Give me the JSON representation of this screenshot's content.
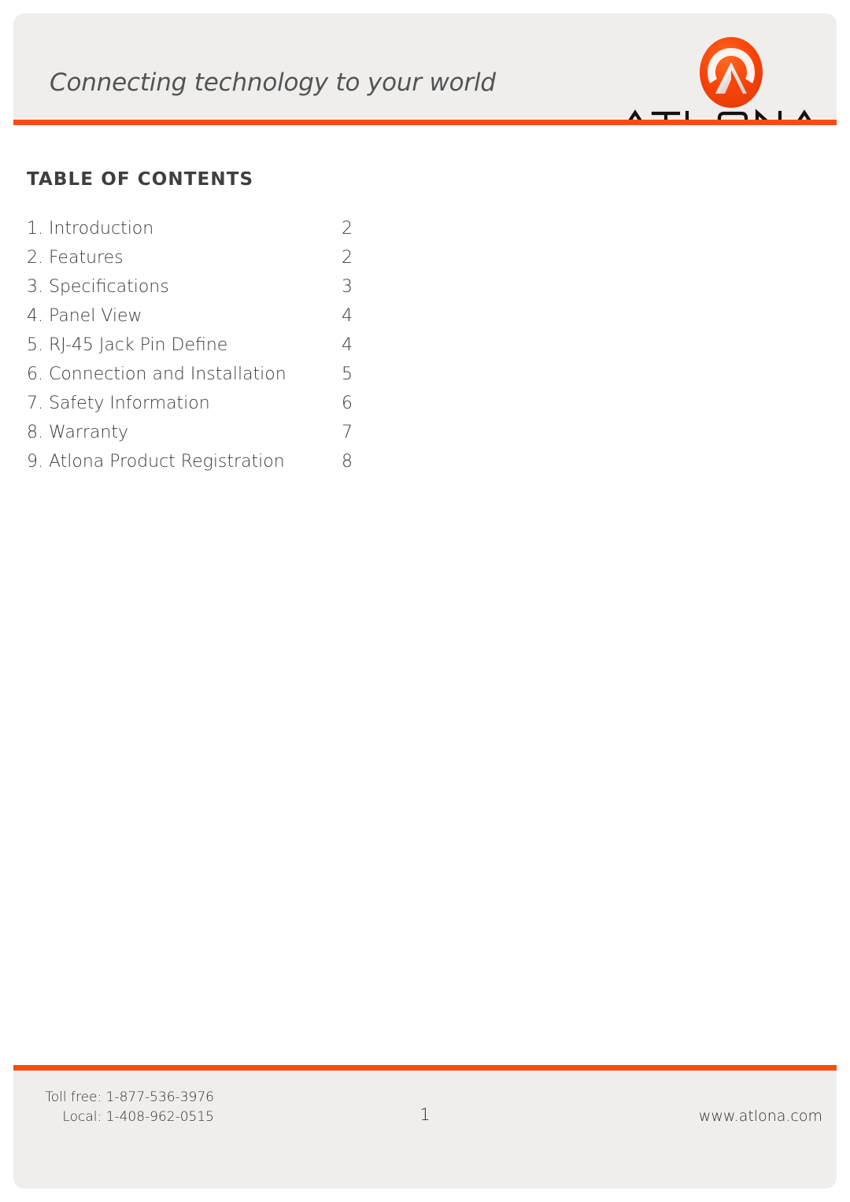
{
  "header": {
    "tagline": "Connecting technology to your world",
    "logo": {
      "wordmark": "ATLONA",
      "badge_name": "atlona-chevron-logo",
      "accent_color": "#f44e12",
      "band_color": "#efeeec"
    }
  },
  "content": {
    "heading": "TABLE OF CONTENTS",
    "toc": [
      {
        "label": "1. Introduction",
        "page": "2"
      },
      {
        "label": "2. Features",
        "page": "2"
      },
      {
        "label": "3. Specifications",
        "page": "3"
      },
      {
        "label": "4. Panel View",
        "page": "4"
      },
      {
        "label": "5. RJ-45 Jack Pin Define",
        "page": "4"
      },
      {
        "label": "6. Connection and Installation",
        "page": "5"
      },
      {
        "label": "7. Safety Information",
        "page": "6"
      },
      {
        "label": "8. Warranty",
        "page": "7"
      },
      {
        "label": "9. Atlona Product Registration",
        "page": "8"
      }
    ]
  },
  "footer": {
    "toll_free": "Toll free: 1-877-536-3976",
    "local": "Local: 1-408-962-0515",
    "page_number": "1",
    "website": "www.atlona.com"
  }
}
